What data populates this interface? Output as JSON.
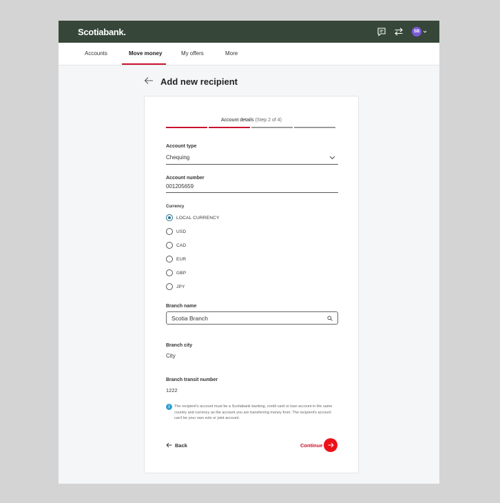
{
  "header": {
    "logo": "Scotiabank.",
    "icons": [
      "chat-icon",
      "transfer-icon"
    ],
    "avatar_initials": "SB"
  },
  "nav": {
    "items": [
      "Accounts",
      "Move money",
      "My offers",
      "More"
    ],
    "active": "Move money"
  },
  "page": {
    "title": "Add new recipient"
  },
  "stepper": {
    "label": "Account details",
    "sub": "(Step 2 of 4)",
    "current_step": 2,
    "total_steps": 4
  },
  "form": {
    "account_type": {
      "label": "Account type",
      "value": "Chequing"
    },
    "account_number": {
      "label": "Account number",
      "value": "001205659"
    },
    "currency": {
      "label": "Currency",
      "options": [
        "LOCAL CURRENCY",
        "USD",
        "CAD",
        "EUR",
        "GBP",
        "JPY"
      ],
      "selected": "LOCAL CURRENCY"
    },
    "branch_name": {
      "label": "Branch name",
      "value": "Scotia Branch"
    },
    "branch_city": {
      "label": "Branch city",
      "value": "City"
    },
    "branch_transit": {
      "label": "Branch transit number",
      "value": "1222"
    }
  },
  "info": {
    "text": "The recipient's account must be a Scotiabank banking, credit card or loan account in the same country and currency as the account you are transferring money from. The recipient's account can't be your own sole or joint account."
  },
  "actions": {
    "back_label": "Back",
    "continue_label": "Continue"
  },
  "colors": {
    "topbar": "#36473a",
    "brand_red": "#c8102e",
    "continue_red": "#ec111a",
    "radio_selected": "#1f6f8b",
    "avatar": "#7b5bd6",
    "info": "#2f9fd0"
  }
}
